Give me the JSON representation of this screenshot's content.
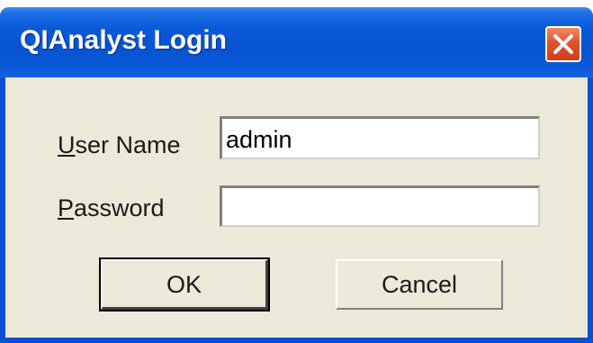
{
  "window": {
    "title": "QIAnalyst Login",
    "title_bar_color": "#0a59d8",
    "close_icon": "close-icon",
    "close_button_color": "#e0532f"
  },
  "form": {
    "username": {
      "label_first": "U",
      "label_rest": "ser Name",
      "value": "admin"
    },
    "password": {
      "label_first": "P",
      "label_rest": "assword",
      "value": ""
    }
  },
  "buttons": {
    "ok_label": "OK",
    "cancel_label": "Cancel"
  }
}
